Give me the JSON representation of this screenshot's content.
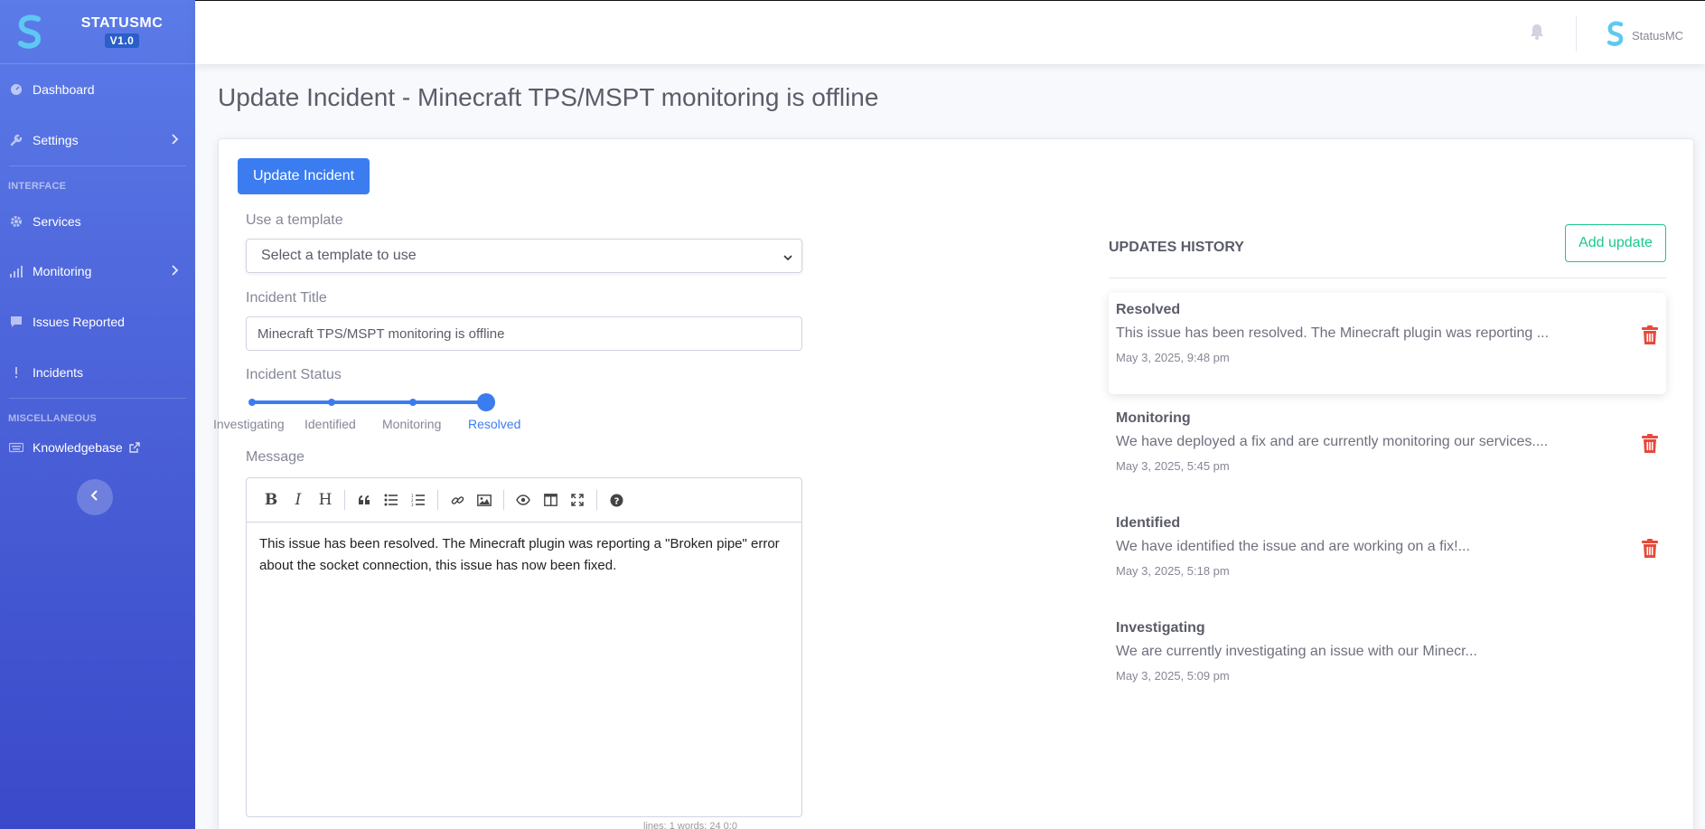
{
  "brand": {
    "name": "STATUSMC",
    "version": "V1.0"
  },
  "sidebar": {
    "items": [
      {
        "label": "Dashboard"
      },
      {
        "label": "Settings"
      },
      {
        "label": "Services"
      },
      {
        "label": "Monitoring"
      },
      {
        "label": "Issues Reported"
      },
      {
        "label": "Incidents"
      },
      {
        "label": "Knowledgebase"
      }
    ],
    "sections": {
      "interface": "INTERFACE",
      "misc": "MISCELLANEOUS"
    }
  },
  "topbar": {
    "user_name": "StatusMC"
  },
  "page": {
    "title": "Update Incident - Minecraft TPS/MSPT monitoring is offline"
  },
  "form": {
    "submit_label": "Update Incident",
    "template_label": "Use a template",
    "template_selected": "Select a template to use",
    "title_label": "Incident Title",
    "title_value": "Minecraft TPS/MSPT monitoring is offline",
    "status_label": "Incident Status",
    "status_options": [
      "Investigating",
      "Identified",
      "Monitoring",
      "Resolved"
    ],
    "status_value": "Resolved",
    "status_index": 3,
    "message_label": "Message",
    "message_text": "This issue has been resolved. The Minecraft plugin was reporting a \"Broken pipe\" error about the socket connection, this issue has now been fixed.",
    "editor_status": "lines: 1    words: 24          0:0"
  },
  "history": {
    "title": "UPDATES HISTORY",
    "add_label": "Add update",
    "updates": [
      {
        "status": "Resolved",
        "message": "This issue has been resolved. The Minecraft plugin was reporting ...",
        "time": "May 3, 2025, 9:48 pm"
      },
      {
        "status": "Monitoring",
        "message": "We have deployed a fix and are currently monitoring our services....",
        "time": "May 3, 2025, 5:45 pm"
      },
      {
        "status": "Identified",
        "message": "We have identified the issue and are working on a fix!...",
        "time": "May 3, 2025, 5:18 pm"
      },
      {
        "status": "Investigating",
        "message": "We are currently investigating an issue with our Minecr...",
        "time": "May 3, 2025, 5:09 pm"
      }
    ]
  },
  "colors": {
    "primary": "#3b7df0",
    "success": "#1cc88a",
    "danger": "#e74a3b",
    "sidebar_top": "#5b7be8",
    "sidebar_bottom": "#3a49c9"
  }
}
